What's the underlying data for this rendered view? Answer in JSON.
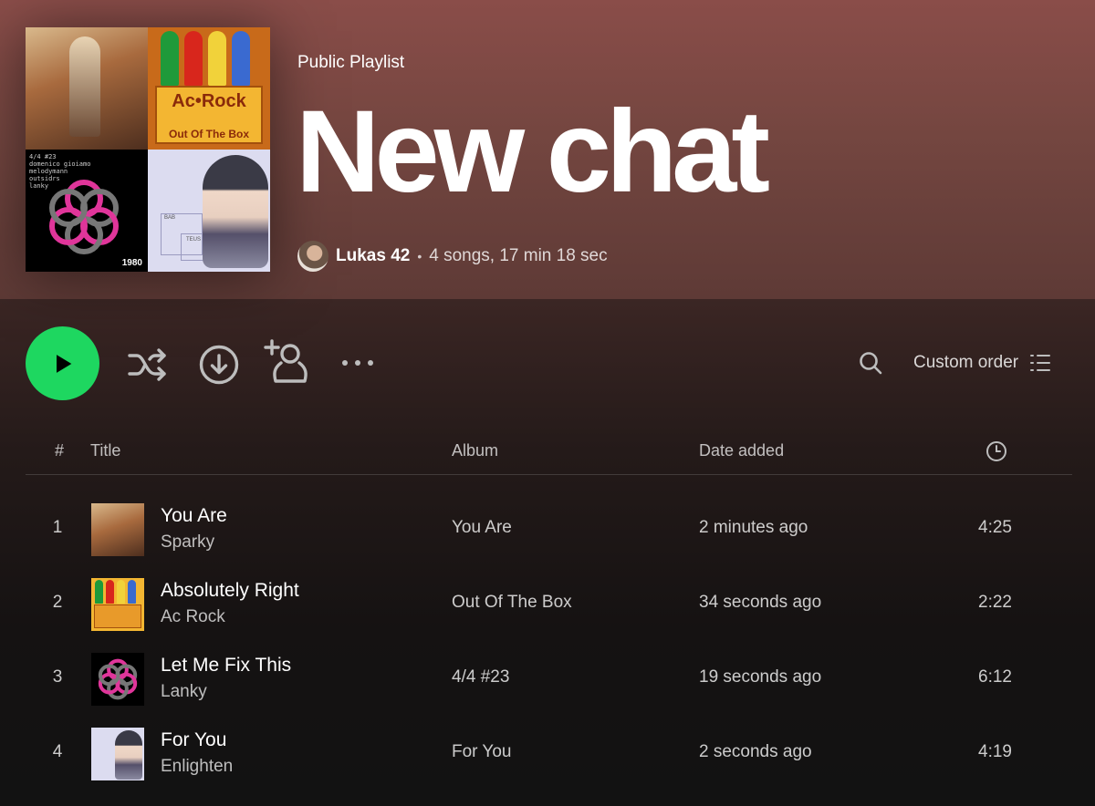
{
  "playlist": {
    "type_label": "Public Playlist",
    "title": "New chat",
    "owner": "Lukas 42",
    "separator": "•",
    "stats": "4 songs, 17 min 18 sec"
  },
  "cover": {
    "tile2_title": "Ac•Rock",
    "tile2_subtitle": "Out Of The Box",
    "tile3_text": "4/4 #23\ndomenico gioiamo\nmelodymann\noutsidrs\nlanky",
    "tile3_label": "1980",
    "tile4_text_a": "BAB",
    "tile4_text_b": "TEUS"
  },
  "actions": {
    "play_icon": "play-icon",
    "shuffle_icon": "shuffle-icon",
    "download_icon": "download-icon",
    "add_user_icon": "add-user-icon",
    "more_icon": "more-icon",
    "search_icon": "search-icon",
    "sort_label": "Custom order",
    "sort_icon": "list-icon"
  },
  "colors": {
    "accent": "#1ed760",
    "hero": "#8a4d49"
  },
  "table": {
    "columns": {
      "number": "#",
      "title": "Title",
      "album": "Album",
      "date_added": "Date added",
      "duration_icon": "clock-icon"
    },
    "rows": [
      {
        "number": "1",
        "title": "You Are",
        "artist": "Sparky",
        "album": "You Are",
        "date_added": "2 minutes ago",
        "duration": "4:25"
      },
      {
        "number": "2",
        "title": "Absolutely Right",
        "artist": "Ac Rock",
        "album": "Out Of The Box",
        "date_added": "34 seconds ago",
        "duration": "2:22"
      },
      {
        "number": "3",
        "title": "Let Me Fix This",
        "artist": "Lanky",
        "album": "4/4 #23",
        "date_added": "19 seconds ago",
        "duration": "6:12"
      },
      {
        "number": "4",
        "title": "For You",
        "artist": "Enlighten",
        "album": "For You",
        "date_added": "2 seconds ago",
        "duration": "4:19"
      }
    ]
  }
}
